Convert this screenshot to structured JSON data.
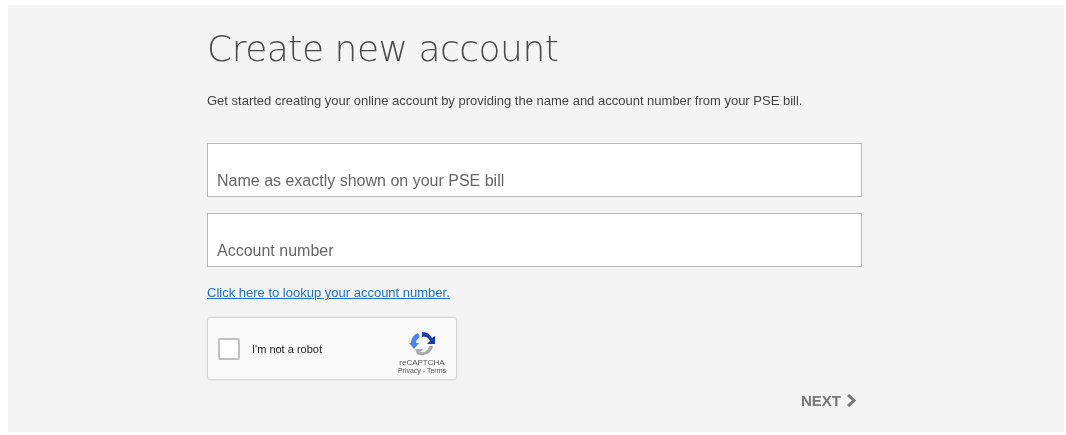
{
  "title": "Create new account",
  "intro": "Get started creating your online account by providing the name and account number from your PSE bill.",
  "fields": [
    {
      "placeholder": "Name as exactly shown on your PSE bill"
    },
    {
      "placeholder": "Account number"
    }
  ],
  "lookup_link": "Click here to lookup your account number.",
  "captcha": {
    "label": "I'm not a robot",
    "checked": false,
    "brand": "reCAPTCHA",
    "links": "Privacy - Terms"
  },
  "next_button": "NEXT"
}
